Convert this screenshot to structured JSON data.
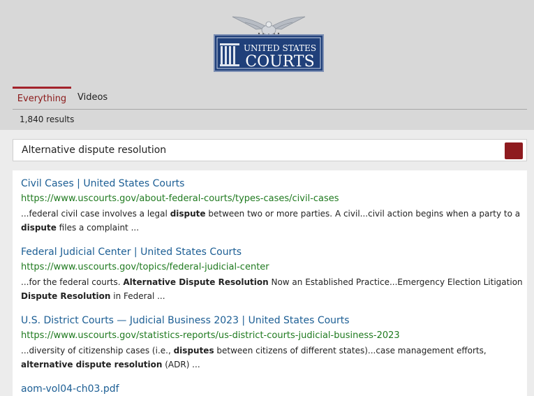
{
  "logo": {
    "line1": "UNITED STATES",
    "line2": "COURTS"
  },
  "tabs": [
    {
      "label": "Everything",
      "active": true
    },
    {
      "label": "Videos",
      "active": false
    }
  ],
  "results_count": "1,840 results",
  "search": {
    "value": "Alternative dispute resolution"
  },
  "colors": {
    "accent": "#8e1b1f",
    "link": "#1c5e94",
    "url": "#1f7a1f"
  },
  "results": [
    {
      "title": "Civil Cases | United States Courts",
      "url": "https://www.uscourts.gov/about-federal-courts/types-cases/civil-cases",
      "snippet": {
        "s1": "...federal civil case involves a legal ",
        "b1": "dispute",
        "s2": " between two or more parties. A civil...civil action begins when a party to a ",
        "b2": "dispute",
        "s3": " files a complaint ..."
      }
    },
    {
      "title": "Federal Judicial Center | United States Courts",
      "url": "https://www.uscourts.gov/topics/federal-judicial-center",
      "snippet": {
        "s1": "...for the federal courts. ",
        "b1": "Alternative Dispute Resolution",
        "s2": " Now an Established Practice...Emergency Election Litigation ",
        "b2": "Dispute Resolution",
        "s3": " in Federal ..."
      }
    },
    {
      "title": "U.S. District Courts — Judicial Business 2023 | United States Courts",
      "url": "https://www.uscourts.gov/statistics-reports/us-district-courts-judicial-business-2023",
      "snippet": {
        "s1": "...diversity of citizenship cases (i.e., ",
        "b1": "disputes",
        "s2": " between citizens of different states)...case management efforts, ",
        "b2": "alternative dispute resolution",
        "s3": " (ADR) ..."
      }
    },
    {
      "title": "aom-vol04-ch03.pdf"
    }
  ]
}
